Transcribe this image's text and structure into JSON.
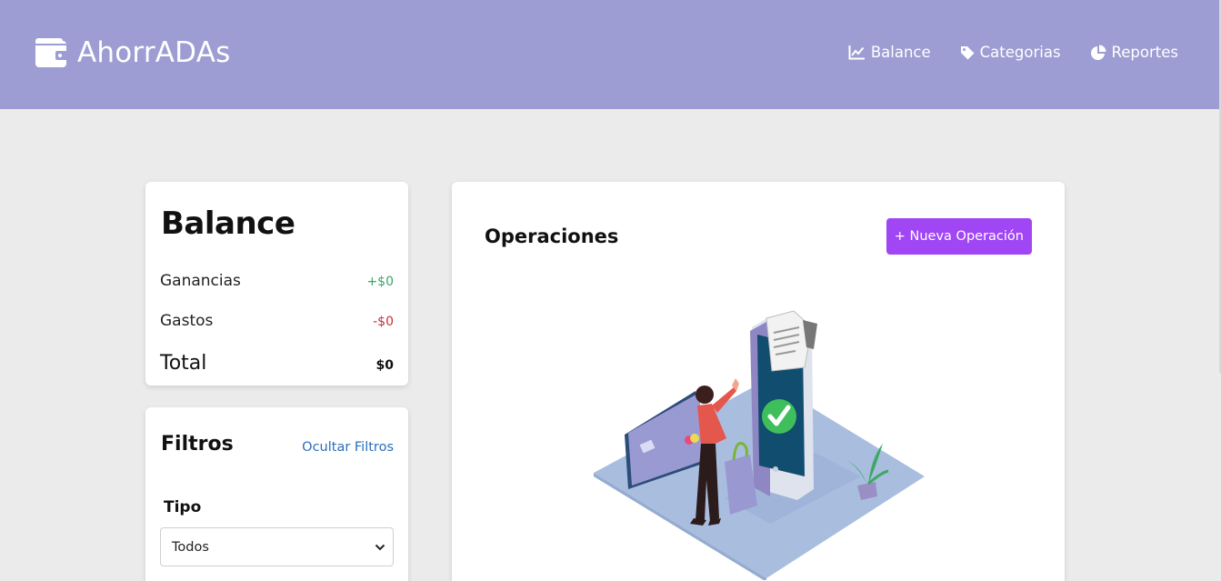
{
  "brand": {
    "name": "AhorrADAs",
    "icon": "wallet-icon"
  },
  "nav": {
    "items": [
      {
        "label": "Balance",
        "icon": "line-chart-icon"
      },
      {
        "label": "Categorias",
        "icon": "tag-icon"
      },
      {
        "label": "Reportes",
        "icon": "pie-chart-icon"
      }
    ]
  },
  "balance": {
    "title": "Balance",
    "ganancias_label": "Ganancias",
    "ganancias_value": "+$0",
    "gastos_label": "Gastos",
    "gastos_value": "-$0",
    "total_label": "Total",
    "total_value": "$0"
  },
  "filters": {
    "title": "Filtros",
    "toggle_label": "Ocultar Filtros",
    "tipo_label": "Tipo",
    "tipo_selected": "Todos"
  },
  "operations": {
    "title": "Operaciones",
    "new_button_label": "+ Nueva Operación"
  },
  "colors": {
    "navbar": "#9d9dd3",
    "background": "#ebebeb",
    "accent_button": "#a046f5",
    "income": "#3aa66b",
    "expense": "#c5303a",
    "link": "#2a6fb8"
  }
}
